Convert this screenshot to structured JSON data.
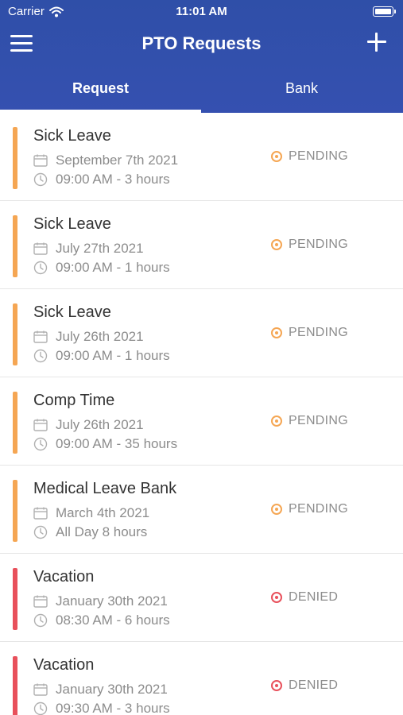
{
  "status_bar": {
    "carrier": "Carrier",
    "time": "11:01 AM"
  },
  "nav": {
    "title": "PTO Requests"
  },
  "tabs": [
    {
      "label": "Request"
    },
    {
      "label": "Bank"
    }
  ],
  "colors": {
    "header": "#3550b0",
    "pending": "#f5a653",
    "denied": "#e8505b",
    "status_text": "#8c8c8c"
  },
  "requests": [
    {
      "title": "Sick Leave",
      "date": "September 7th 2021",
      "time": "09:00 AM - 3 hours",
      "status": "PENDING",
      "status_color": "#f5a653"
    },
    {
      "title": "Sick Leave",
      "date": "July 27th 2021",
      "time": "09:00 AM - 1 hours",
      "status": "PENDING",
      "status_color": "#f5a653"
    },
    {
      "title": "Sick Leave",
      "date": "July 26th 2021",
      "time": "09:00 AM - 1 hours",
      "status": "PENDING",
      "status_color": "#f5a653"
    },
    {
      "title": "Comp Time",
      "date": "July 26th 2021",
      "time": "09:00 AM - 35 hours",
      "status": "PENDING",
      "status_color": "#f5a653"
    },
    {
      "title": "Medical Leave Bank",
      "date": "March 4th 2021",
      "time": "All Day 8 hours",
      "status": "PENDING",
      "status_color": "#f5a653"
    },
    {
      "title": "Vacation",
      "date": "January 30th 2021",
      "time": "08:30 AM - 6 hours",
      "status": "DENIED",
      "status_color": "#e8505b"
    },
    {
      "title": "Vacation",
      "date": "January 30th 2021",
      "time": "09:30 AM - 3 hours",
      "status": "DENIED",
      "status_color": "#e8505b"
    }
  ]
}
